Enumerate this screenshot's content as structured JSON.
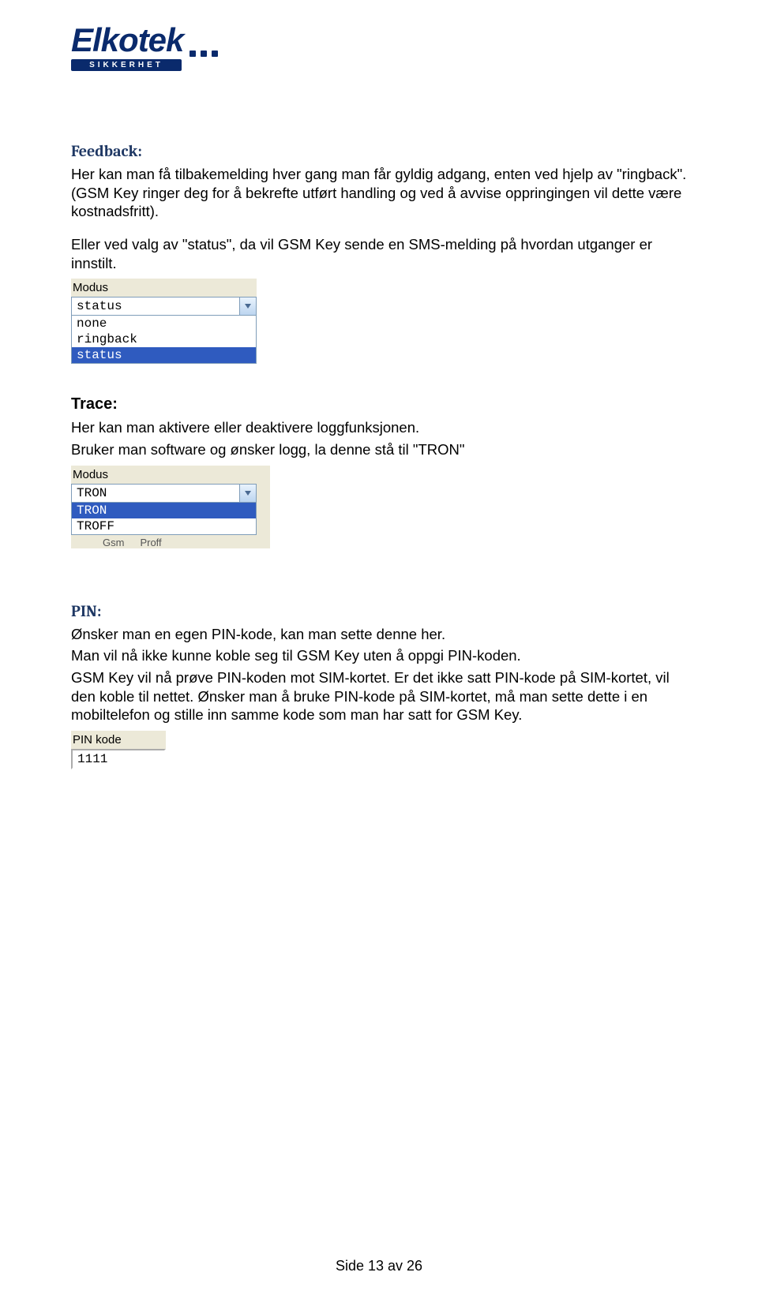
{
  "logo": {
    "brand": "Elkotek",
    "tagline": "SIKKERHET"
  },
  "feedback": {
    "heading": "Feedback:",
    "p1": "Her kan man få tilbakemelding hver gang man får gyldig adgang, enten ved hjelp av \"ringback\". (GSM Key ringer deg for å bekrefte utført handling og ved å avvise oppringingen vil dette være kostnadsfritt).",
    "p2": "Eller ved valg av \"status\", da vil GSM Key sende en SMS-melding på hvordan utganger er innstilt."
  },
  "feedback_widget": {
    "label": "Modus",
    "value": "status",
    "options": [
      "none",
      "ringback",
      "status"
    ],
    "selected_index": 2
  },
  "trace": {
    "heading": "Trace:",
    "p1": "Her kan man aktivere eller deaktivere loggfunksjonen.",
    "p2": "Bruker man software og ønsker logg, la denne stå til \"TRON\""
  },
  "trace_widget": {
    "label": "Modus",
    "value": "TRON",
    "options": [
      "TRON",
      "TROFF"
    ],
    "selected_index": 0,
    "tabs": [
      "Gsm",
      "Proff"
    ]
  },
  "pin": {
    "heading": "PIN:",
    "p1": "Ønsker man en egen PIN-kode, kan man sette denne her.",
    "p2": "Man vil nå ikke kunne koble seg til GSM Key uten å oppgi PIN-koden.",
    "p3": "GSM Key vil nå prøve PIN-koden mot SIM-kortet. Er det ikke satt PIN-kode på SIM-kortet, vil den koble til nettet. Ønsker man å bruke PIN-kode på SIM-kortet, må man sette dette i en mobiltelefon og stille inn samme kode som man har satt for GSM Key."
  },
  "pin_widget": {
    "label": "PIN kode",
    "value": "1111"
  },
  "footer": "Side 13 av 26"
}
